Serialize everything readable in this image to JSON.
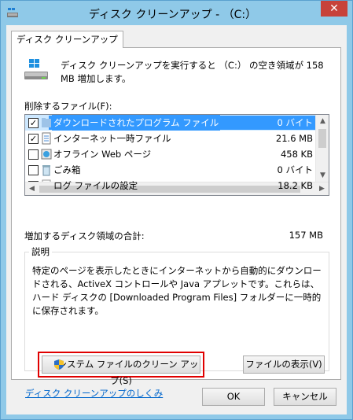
{
  "window": {
    "title": "ディスク クリーンアップ - （C:）",
    "close_label": "✕"
  },
  "tab": {
    "label": "ディスク クリーンアップ"
  },
  "summary": "ディスク クリーンアップを実行すると （C:） の空き領域が 158 MB 増加します。",
  "files_label": "削除するファイル(F):",
  "files": [
    {
      "name": "ダウンロードされたプログラム ファイル",
      "size": "0 バイト",
      "checked": true,
      "selected": true
    },
    {
      "name": "インターネット一時ファイル",
      "size": "21.6 MB",
      "checked": true,
      "selected": false
    },
    {
      "name": "オフライン Web ページ",
      "size": "458 KB",
      "checked": false,
      "selected": false
    },
    {
      "name": "ごみ箱",
      "size": "0 バイト",
      "checked": false,
      "selected": false
    },
    {
      "name": "ログ ファイルの設定",
      "size": "18.2 KB",
      "checked": false,
      "selected": false
    }
  ],
  "total_label": "増加するディスク領域の合計:",
  "total_value": "157 MB",
  "description_label": "説明",
  "description": "特定のページを表示したときにインターネットから自動的にダウンロードされる、ActiveX コントロールや Java アプレットです。これらは、ハード ディスクの [Downloaded Program Files] フォルダーに一時的に保存されます。",
  "buttons": {
    "cleanup_system": "システム ファイルのクリーン アップ(S)",
    "view_files": "ファイルの表示(V)",
    "ok": "OK",
    "cancel": "キャンセル"
  },
  "link": "ディスク クリーンアップのしくみ",
  "colors": {
    "titlebar": "#8fc9e8",
    "close": "#c7423a",
    "selection": "#3399ff",
    "highlight_box": "#e00000",
    "link": "#0066cc"
  }
}
